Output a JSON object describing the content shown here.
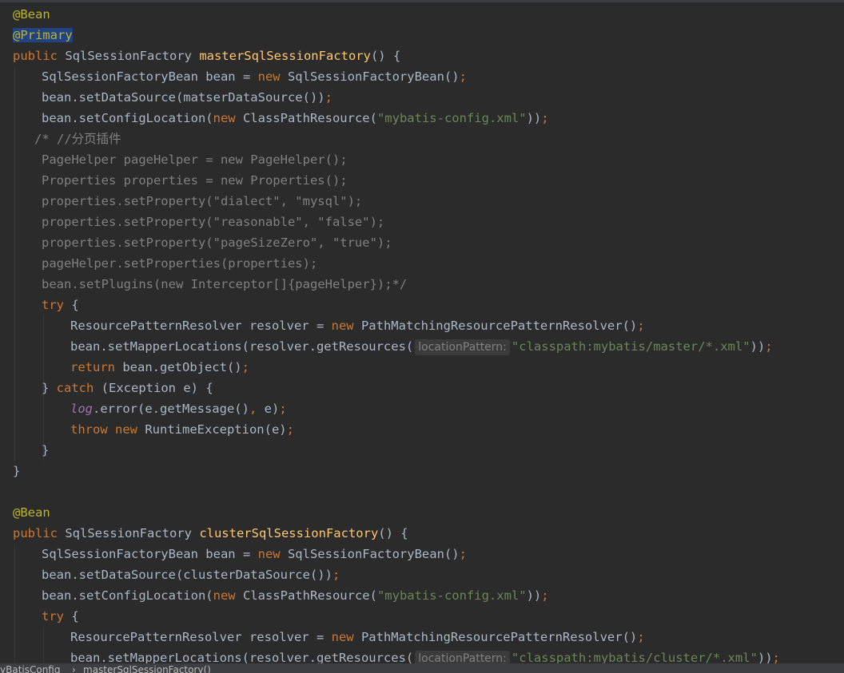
{
  "editor": {
    "lines": [
      {
        "indent": 0,
        "tokens": [
          {
            "t": "@Bean",
            "c": "annot"
          }
        ]
      },
      {
        "indent": 0,
        "tokens": [
          {
            "t": "@Primary",
            "c": "selected"
          }
        ]
      },
      {
        "indent": 0,
        "tokens": [
          {
            "t": "public ",
            "c": "kw"
          },
          {
            "t": "SqlSessionFactory ",
            "c": "default"
          },
          {
            "t": "masterSqlSessionFactory",
            "c": "method"
          },
          {
            "t": "() {",
            "c": "default"
          }
        ]
      },
      {
        "indent": 1,
        "tokens": [
          {
            "t": "SqlSessionFactoryBean bean = ",
            "c": "default"
          },
          {
            "t": "new ",
            "c": "kw"
          },
          {
            "t": "SqlSessionFactoryBean()",
            "c": "default"
          },
          {
            "t": ";",
            "c": "semi"
          }
        ]
      },
      {
        "indent": 1,
        "tokens": [
          {
            "t": "bean.setDataSource(matserDataSource())",
            "c": "default"
          },
          {
            "t": ";",
            "c": "semi"
          }
        ]
      },
      {
        "indent": 1,
        "tokens": [
          {
            "t": "bean.setConfigLocation(",
            "c": "default"
          },
          {
            "t": "new ",
            "c": "kw"
          },
          {
            "t": "ClassPathResource(",
            "c": "default"
          },
          {
            "t": "\"mybatis-config.xml\"",
            "c": "str"
          },
          {
            "t": "))",
            "c": "default"
          },
          {
            "t": ";",
            "c": "semi"
          }
        ]
      },
      {
        "indent": 0,
        "prefix": "   ",
        "tokens": [
          {
            "t": "/* //分页插件",
            "c": "comment"
          }
        ]
      },
      {
        "indent": 1,
        "tokens": [
          {
            "t": "PageHelper pageHelper = new PageHelper();",
            "c": "comment"
          }
        ]
      },
      {
        "indent": 1,
        "tokens": [
          {
            "t": "Properties properties = new Properties();",
            "c": "comment"
          }
        ]
      },
      {
        "indent": 1,
        "tokens": [
          {
            "t": "properties.setProperty(\"dialect\", \"mysql\");",
            "c": "comment"
          }
        ]
      },
      {
        "indent": 1,
        "tokens": [
          {
            "t": "properties.setProperty(\"reasonable\", \"false\");",
            "c": "comment"
          }
        ]
      },
      {
        "indent": 1,
        "tokens": [
          {
            "t": "properties.setProperty(\"pageSizeZero\", \"true\");",
            "c": "comment"
          }
        ]
      },
      {
        "indent": 1,
        "tokens": [
          {
            "t": "pageHelper.setProperties(properties);",
            "c": "comment"
          }
        ]
      },
      {
        "indent": 1,
        "tokens": [
          {
            "t": "bean.setPlugins(new Interceptor[]{pageHelper});*/",
            "c": "comment"
          }
        ]
      },
      {
        "indent": 1,
        "tokens": [
          {
            "t": "try ",
            "c": "kw"
          },
          {
            "t": "{",
            "c": "default"
          }
        ]
      },
      {
        "indent": 2,
        "tokens": [
          {
            "t": "ResourcePatternResolver resolver = ",
            "c": "default"
          },
          {
            "t": "new ",
            "c": "kw"
          },
          {
            "t": "PathMatchingResourcePatternResolver()",
            "c": "default"
          },
          {
            "t": ";",
            "c": "semi"
          }
        ]
      },
      {
        "indent": 2,
        "tokens": [
          {
            "t": "bean.setMapperLocations(resolver.getResources(",
            "c": "default"
          },
          {
            "t": "locationPattern:",
            "c": "hint"
          },
          {
            "t": "\"classpath:mybatis/master/*.xml\"",
            "c": "str"
          },
          {
            "t": "))",
            "c": "default"
          },
          {
            "t": ";",
            "c": "semi"
          }
        ]
      },
      {
        "indent": 2,
        "tokens": [
          {
            "t": "return ",
            "c": "kw"
          },
          {
            "t": "bean.getObject()",
            "c": "default"
          },
          {
            "t": ";",
            "c": "semi"
          }
        ]
      },
      {
        "indent": 1,
        "tokens": [
          {
            "t": "} ",
            "c": "default"
          },
          {
            "t": "catch ",
            "c": "kw"
          },
          {
            "t": "(Exception e) {",
            "c": "default"
          }
        ]
      },
      {
        "indent": 2,
        "tokens": [
          {
            "t": "log",
            "c": "italic"
          },
          {
            "t": ".error(e.getMessage()",
            "c": "default"
          },
          {
            "t": ", ",
            "c": "semi"
          },
          {
            "t": "e)",
            "c": "default"
          },
          {
            "t": ";",
            "c": "semi"
          }
        ]
      },
      {
        "indent": 2,
        "tokens": [
          {
            "t": "throw ",
            "c": "kw"
          },
          {
            "t": "new ",
            "c": "kw"
          },
          {
            "t": "RuntimeException(e)",
            "c": "default"
          },
          {
            "t": ";",
            "c": "semi"
          }
        ]
      },
      {
        "indent": 1,
        "tokens": [
          {
            "t": "}",
            "c": "default"
          }
        ]
      },
      {
        "indent": 0,
        "tokens": [
          {
            "t": "}",
            "c": "default"
          }
        ]
      },
      {
        "indent": 0,
        "tokens": []
      },
      {
        "indent": 0,
        "tokens": [
          {
            "t": "@Bean",
            "c": "annot"
          }
        ]
      },
      {
        "indent": 0,
        "tokens": [
          {
            "t": "public ",
            "c": "kw"
          },
          {
            "t": "SqlSessionFactory ",
            "c": "default"
          },
          {
            "t": "clusterSqlSessionFactory",
            "c": "method"
          },
          {
            "t": "() {",
            "c": "default"
          }
        ]
      },
      {
        "indent": 1,
        "tokens": [
          {
            "t": "SqlSessionFactoryBean bean = ",
            "c": "default"
          },
          {
            "t": "new ",
            "c": "kw"
          },
          {
            "t": "SqlSessionFactoryBean()",
            "c": "default"
          },
          {
            "t": ";",
            "c": "semi"
          }
        ]
      },
      {
        "indent": 1,
        "tokens": [
          {
            "t": "bean.setDataSource(clusterDataSource())",
            "c": "default"
          },
          {
            "t": ";",
            "c": "semi"
          }
        ]
      },
      {
        "indent": 1,
        "tokens": [
          {
            "t": "bean.setConfigLocation(",
            "c": "default"
          },
          {
            "t": "new ",
            "c": "kw"
          },
          {
            "t": "ClassPathResource(",
            "c": "default"
          },
          {
            "t": "\"mybatis-config.xml\"",
            "c": "str"
          },
          {
            "t": "))",
            "c": "default"
          },
          {
            "t": ";",
            "c": "semi"
          }
        ]
      },
      {
        "indent": 1,
        "tokens": [
          {
            "t": "try ",
            "c": "kw"
          },
          {
            "t": "{",
            "c": "default"
          }
        ]
      },
      {
        "indent": 2,
        "tokens": [
          {
            "t": "ResourcePatternResolver resolver = ",
            "c": "default"
          },
          {
            "t": "new ",
            "c": "kw"
          },
          {
            "t": "PathMatchingResourcePatternResolver()",
            "c": "default"
          },
          {
            "t": ";",
            "c": "semi"
          }
        ]
      },
      {
        "indent": 2,
        "tokens": [
          {
            "t": "bean.setMapperLocations(resolver.getResources(",
            "c": "default"
          },
          {
            "t": "locationPattern:",
            "c": "hint"
          },
          {
            "t": "\"classpath:mybatis/cluster/*.xml\"",
            "c": "str"
          },
          {
            "t": "))",
            "c": "default"
          },
          {
            "t": ";",
            "c": "semi"
          }
        ]
      }
    ]
  },
  "breadcrumb": {
    "class_name": "yBatisConfig",
    "separator": "›",
    "method_name": "masterSqlSessionFactory()"
  }
}
